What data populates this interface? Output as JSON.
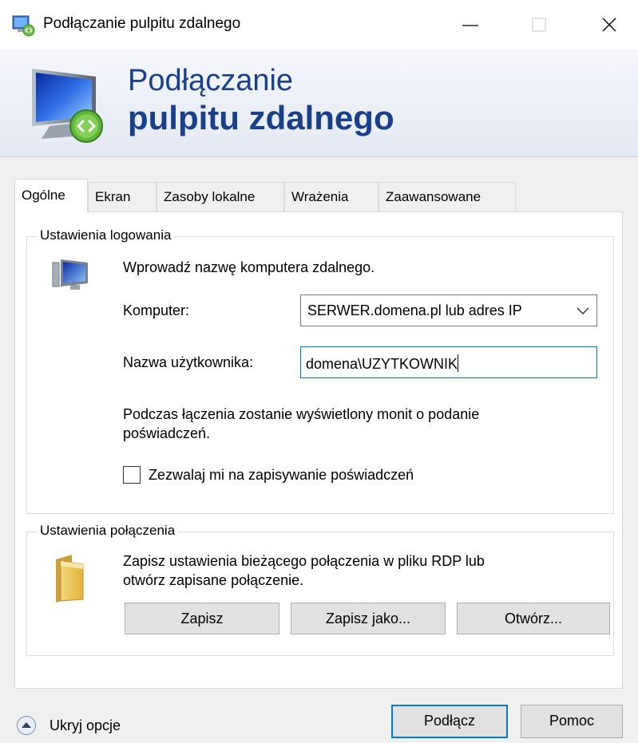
{
  "window": {
    "title": "Podłączanie pulpitu zdalnego",
    "controls": {
      "minimize": "—",
      "maximize": "☐",
      "close": "✕"
    }
  },
  "banner": {
    "line1": "Podłączanie",
    "line2": "pulpitu zdalnego",
    "icon": "remote-desktop-icon"
  },
  "tabs": [
    {
      "label": "Ogólne",
      "active": true
    },
    {
      "label": "Ekran"
    },
    {
      "label": "Zasoby lokalne"
    },
    {
      "label": "Wrażenia"
    },
    {
      "label": "Zaawansowane"
    }
  ],
  "login_settings": {
    "group_title": "Ustawienia logowania",
    "instruction": "Wprowadź nazwę komputera zdalnego.",
    "computer_label": "Komputer:",
    "computer_value": "SERWER.domena.pl lub adres IP",
    "username_label": "Nazwa użytkownika:",
    "username_value": "domena\\UZYTKOWNIK",
    "prompt_line1": "Podczas łączenia zostanie wyświetlony monit o podanie",
    "prompt_line2": "poświadczeń.",
    "save_credentials_label": "Zezwalaj mi na zapisywanie poświadczeń",
    "save_credentials_checked": false
  },
  "connection_settings": {
    "group_title": "Ustawienia połączenia",
    "desc_line1": "Zapisz ustawienia bieżącego połączenia w pliku RDP lub",
    "desc_line2": "otwórz zapisane połączenie.",
    "save_label": "Zapisz",
    "save_as_label": "Zapisz jako...",
    "open_label": "Otwórz..."
  },
  "footer": {
    "hide_options_label": "Ukryj opcje",
    "connect_label": "Podłącz",
    "help_label": "Pomoc"
  },
  "colors": {
    "accent": "#0078d7",
    "banner_text": "#1a3f8b"
  }
}
